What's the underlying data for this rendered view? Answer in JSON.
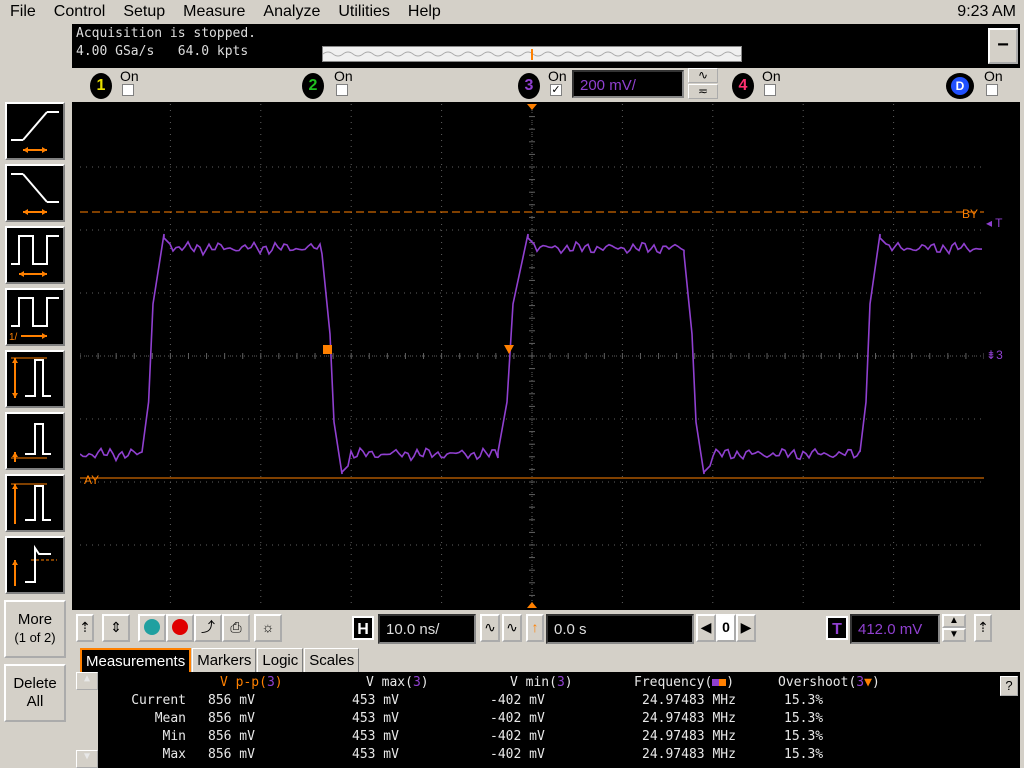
{
  "menu": {
    "items": [
      "File",
      "Control",
      "Setup",
      "Measure",
      "Analyze",
      "Utilities",
      "Help"
    ],
    "clock": "9:23 AM"
  },
  "acquisition": {
    "status": "Acquisition is stopped.",
    "rate": "4.00 GSa/s",
    "points": "64.0 kpts"
  },
  "channels": [
    {
      "num": "1",
      "label": "On",
      "checked": false,
      "color": "#e8e000"
    },
    {
      "num": "2",
      "label": "On",
      "checked": false,
      "color": "#20c020"
    },
    {
      "num": "3",
      "label": "On",
      "checked": true,
      "color": "#9040d0",
      "scale": "200 mV/"
    },
    {
      "num": "4",
      "label": "On",
      "checked": false,
      "color": "#ff3070"
    },
    {
      "num": "D",
      "label": "On",
      "checked": false,
      "color": "#2050ff"
    }
  ],
  "sidebar": {
    "more_label": "More",
    "more_sub": "(1 of 2)",
    "delete_label": "Delete",
    "delete_sub": "All"
  },
  "markers": {
    "by_label": "BY",
    "ay_label": "AY",
    "trigger_label": "T",
    "ch3_ref": "3"
  },
  "horizontal": {
    "label": "H",
    "timebase": "10.0 ns/",
    "position": "0.0 s",
    "ref_value": "0"
  },
  "trigger": {
    "label": "T",
    "level": "412.0 mV"
  },
  "tabs": [
    "Measurements",
    "Markers",
    "Logic",
    "Scales"
  ],
  "measurements": {
    "headers": [
      {
        "name": "V p-p",
        "src": "3"
      },
      {
        "name": "V max",
        "src": "3"
      },
      {
        "name": "V min",
        "src": "3"
      },
      {
        "name": "Frequency",
        "src": ""
      },
      {
        "name": "Overshoot",
        "src": "3"
      }
    ],
    "rows": [
      {
        "label": "Current",
        "values": [
          "856 mV",
          "453 mV",
          "-402 mV",
          "24.97483 MHz",
          "15.3%"
        ]
      },
      {
        "label": "Mean",
        "values": [
          "856 mV",
          "453 mV",
          "-402 mV",
          "24.97483 MHz",
          "15.3%"
        ]
      },
      {
        "label": "Min",
        "values": [
          "856 mV",
          "453 mV",
          "-402 mV",
          "24.97483 MHz",
          "15.3%"
        ]
      },
      {
        "label": "Max",
        "values": [
          "856 mV",
          "453 mV",
          "-402 mV",
          "24.97483 MHz",
          "15.3%"
        ]
      }
    ],
    "help": "?"
  },
  "colors": {
    "ch3": "#9040d0",
    "marker": "#ff8000",
    "grid": "#606060"
  }
}
